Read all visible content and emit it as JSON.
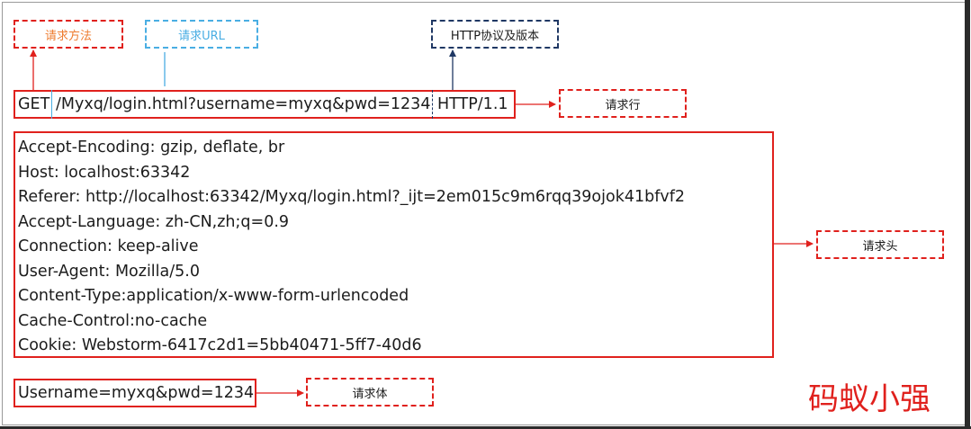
{
  "labels": {
    "method": "请求方法",
    "url": "请求URL",
    "protocol": "HTTP协议及版本",
    "request_line": "请求行",
    "request_headers": "请求头",
    "request_body": "请求体"
  },
  "request_line": {
    "method": "GET",
    "url": "/Myxq/login.html?username=myxq&pwd=1234",
    "version": "HTTP/1.1"
  },
  "headers": [
    "Accept-Encoding: gzip, deflate, br",
    "Host: localhost:63342",
    "Referer: http://localhost:63342/Myxq/login.html?_ijt=2em015c9m6rqq39ojok41bfvf2",
    "Accept-Language: zh-CN,zh;q=0.9",
    "Connection: keep-alive",
    "User-Agent: Mozilla/5.0",
    "Content-Type:application/x-www-form-urlencoded",
    "Cache-Control:no-cache",
    "Cookie: Webstorm-6417c2d1=5bb40471-5ff7-40d6"
  ],
  "body": "Username=myxq&pwd=1234",
  "watermark": "码蚁小强",
  "colors": {
    "red": "#e0211d",
    "orange": "#ee7d31",
    "blue": "#4aaee3",
    "navy": "#1f3864",
    "text": "#1c1c1c"
  }
}
